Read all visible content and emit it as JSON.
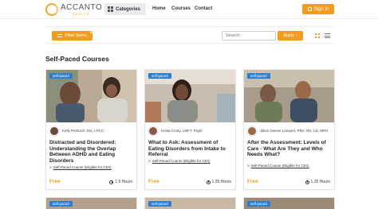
{
  "header": {
    "logo_text": "ACCANTO",
    "logo_sub": "HEALTH",
    "categories_label": "Categories",
    "nav": [
      "Home",
      "Courses",
      "Contact"
    ],
    "signin_label": "Sign In"
  },
  "filterbar": {
    "filter_label": "Filter Items",
    "search_placeholder": "Search",
    "apply_label": "Apply"
  },
  "section_title": "Self-Paced Courses",
  "cards": [
    {
      "badge": "self-paced",
      "author": "Kelly Pertzsch, MA, LPCC",
      "title": "Distracted and Disordered: Understanding the Overlap Between ADHD and Eating Disorders",
      "meta_prefix": "in",
      "meta_link": "Self-Paced Course (Eligible for CEs)",
      "price": "Free",
      "duration": "1.5 Hours"
    },
    {
      "badge": "self-paced",
      "author": "Krista Crotty, LMFT, PsyD",
      "title": "What to Ask: Assessment of Eating Disorders from Intake to Referral",
      "meta_prefix": "in",
      "meta_link": "Self-Paced Course (Eligible for CEs)",
      "price": "Free",
      "duration": "1.25 Hours"
    },
    {
      "badge": "self-paced",
      "author": "Jillian Garner Lampert, PhD, RD, LD, MPH",
      "title": "After the Assessment: Levels of Care - What Are They and Who Needs What?",
      "meta_prefix": "in",
      "meta_link": "Self-Paced Course (Eligible for CEs)",
      "price": "Free",
      "duration": "1.25 Hours"
    }
  ],
  "row2_badges": [
    "self-paced",
    "self-paced",
    "self-paced"
  ],
  "colors": {
    "accent": "#f29b1d",
    "badge": "#2b7fd3"
  }
}
